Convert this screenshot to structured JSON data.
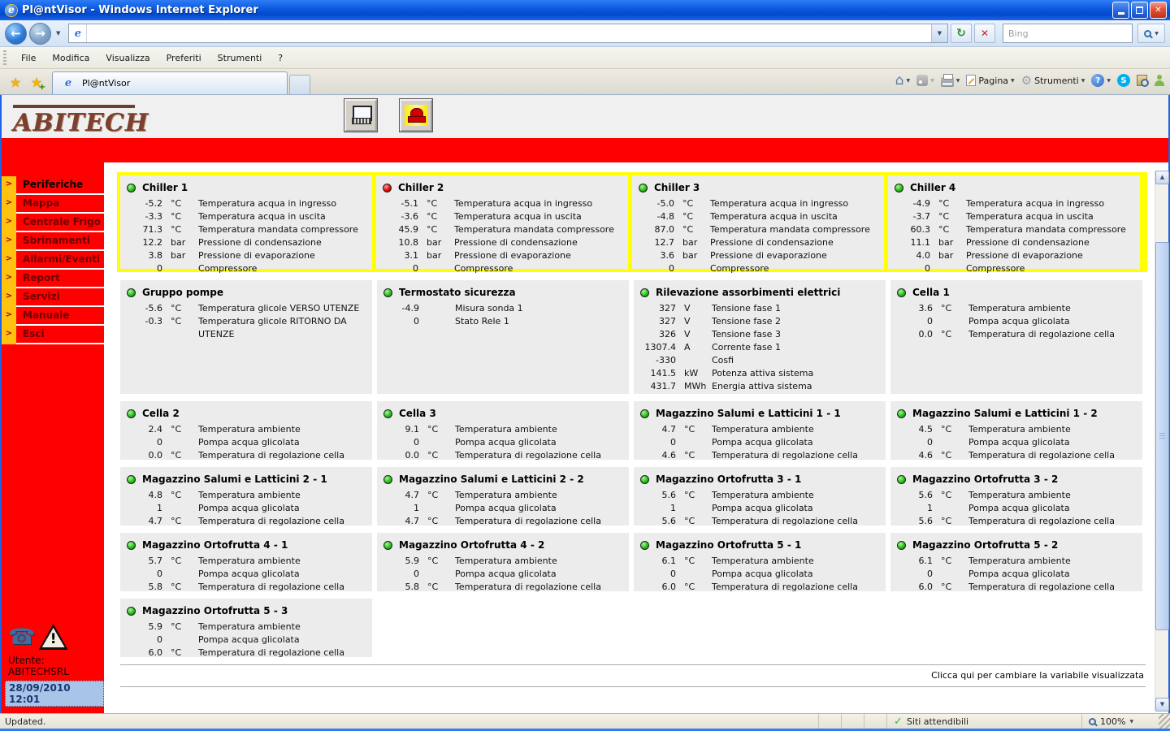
{
  "window": {
    "title": "Pl@ntVisor - Windows Internet Explorer"
  },
  "browser": {
    "menu_items": [
      "File",
      "Modifica",
      "Visualizza",
      "Preferiti",
      "Strumenti",
      "?"
    ],
    "tab_title": "Pl@ntVisor",
    "search_placeholder": "Bing",
    "toolbar": {
      "pagina_label": "Pagina",
      "strumenti_label": "Strumenti"
    }
  },
  "app": {
    "logo_text": "ABITECH",
    "sidebar": {
      "items": [
        {
          "label": "Periferiche",
          "active": true
        },
        {
          "label": "Mappa",
          "active": false
        },
        {
          "label": "Centrale Frigo",
          "active": false
        },
        {
          "label": "Sbrinamenti",
          "active": false
        },
        {
          "label": "Allarmi/Eventi",
          "active": false
        },
        {
          "label": "Report",
          "active": false
        },
        {
          "label": "Servizi",
          "active": false
        },
        {
          "label": "Manuale",
          "active": false
        },
        {
          "label": "Esci",
          "active": false
        }
      ],
      "user_label": "Utente:",
      "user_name": "ABITECHSRL",
      "datetime": "28/09/2010 12:01"
    },
    "footer_hint": "Clicca qui per cambiare la variabile visualizzata",
    "colors": {
      "led_green": "#22B714",
      "led_red": "#DE0000",
      "sidebar_red": "#FF0000",
      "highlight_yellow": "#FFFF00",
      "panel_gray": "#ECECEC"
    },
    "panel_rows": [
      {
        "highlight": true,
        "panels": [
          {
            "name": "Chiller 1",
            "led": "green",
            "rows": [
              [
                "-5.2",
                "°C",
                "Temperatura acqua in ingresso"
              ],
              [
                "-3.3",
                "°C",
                "Temperatura acqua in uscita"
              ],
              [
                "71.3",
                "°C",
                "Temperatura mandata compressore"
              ],
              [
                "12.2",
                "bar",
                "Pressione di condensazione"
              ],
              [
                "3.8",
                "bar",
                "Pressione di evaporazione"
              ],
              [
                "0",
                "",
                "Compressore"
              ]
            ]
          },
          {
            "name": "Chiller 2",
            "led": "red",
            "rows": [
              [
                "-5.1",
                "°C",
                "Temperatura acqua in ingresso"
              ],
              [
                "-3.6",
                "°C",
                "Temperatura acqua in uscita"
              ],
              [
                "45.9",
                "°C",
                "Temperatura mandata compressore"
              ],
              [
                "10.8",
                "bar",
                "Pressione di condensazione"
              ],
              [
                "3.1",
                "bar",
                "Pressione di evaporazione"
              ],
              [
                "0",
                "",
                "Compressore"
              ]
            ]
          },
          {
            "name": "Chiller 3",
            "led": "green",
            "rows": [
              [
                "-5.0",
                "°C",
                "Temperatura acqua in ingresso"
              ],
              [
                "-4.8",
                "°C",
                "Temperatura acqua in uscita"
              ],
              [
                "87.0",
                "°C",
                "Temperatura mandata compressore"
              ],
              [
                "12.7",
                "bar",
                "Pressione di condensazione"
              ],
              [
                "3.6",
                "bar",
                "Pressione di evaporazione"
              ],
              [
                "0",
                "",
                "Compressore"
              ]
            ]
          },
          {
            "name": "Chiller 4",
            "led": "green",
            "rows": [
              [
                "-4.9",
                "°C",
                "Temperatura acqua in ingresso"
              ],
              [
                "-3.7",
                "°C",
                "Temperatura acqua in uscita"
              ],
              [
                "60.3",
                "°C",
                "Temperatura mandata compressore"
              ],
              [
                "11.1",
                "bar",
                "Pressione di condensazione"
              ],
              [
                "4.0",
                "bar",
                "Pressione di evaporazione"
              ],
              [
                "0",
                "",
                "Compressore"
              ]
            ]
          }
        ]
      },
      {
        "highlight": false,
        "panels": [
          {
            "name": "Gruppo pompe",
            "led": "green",
            "rows": [
              [
                "-5.6",
                "°C",
                "Temperatura glicole VERSO UTENZE"
              ],
              [
                "-0.3",
                "°C",
                "Temperatura glicole RITORNO DA UTENZE"
              ]
            ]
          },
          {
            "name": "Termostato sicurezza",
            "led": "green",
            "rows": [
              [
                "-4.9",
                "",
                "Misura sonda 1"
              ],
              [
                "0",
                "",
                "Stato Rele 1"
              ]
            ]
          },
          {
            "name": "Rilevazione assorbimenti elettrici",
            "led": "green",
            "rows": [
              [
                "327",
                "V",
                "Tensione fase 1"
              ],
              [
                "327",
                "V",
                "Tensione fase 2"
              ],
              [
                "326",
                "V",
                "Tensione fase 3"
              ],
              [
                "1307.4",
                "A",
                "Corrente fase 1"
              ],
              [
                "-330",
                "",
                "Cosfi"
              ],
              [
                "141.5",
                "kW",
                "Potenza attiva sistema"
              ],
              [
                "431.7",
                "MWh",
                "Energia attiva sistema"
              ]
            ]
          },
          {
            "name": "Cella 1",
            "led": "green",
            "rows": [
              [
                "3.6",
                "°C",
                "Temperatura ambiente"
              ],
              [
                "0",
                "",
                "Pompa acqua glicolata"
              ],
              [
                "0.0",
                "°C",
                "Temperatura di regolazione cella"
              ]
            ]
          }
        ]
      },
      {
        "highlight": false,
        "panels": [
          {
            "name": "Cella 2",
            "led": "green",
            "rows": [
              [
                "2.4",
                "°C",
                "Temperatura ambiente"
              ],
              [
                "0",
                "",
                "Pompa acqua glicolata"
              ],
              [
                "0.0",
                "°C",
                "Temperatura di regolazione cella"
              ]
            ]
          },
          {
            "name": "Cella 3",
            "led": "green",
            "rows": [
              [
                "9.1",
                "°C",
                "Temperatura ambiente"
              ],
              [
                "0",
                "",
                "Pompa acqua glicolata"
              ],
              [
                "0.0",
                "°C",
                "Temperatura di regolazione cella"
              ]
            ]
          },
          {
            "name": "Magazzino Salumi e Latticini 1 - 1",
            "led": "green",
            "rows": [
              [
                "4.7",
                "°C",
                "Temperatura ambiente"
              ],
              [
                "0",
                "",
                "Pompa acqua glicolata"
              ],
              [
                "4.6",
                "°C",
                "Temperatura di regolazione cella"
              ]
            ]
          },
          {
            "name": "Magazzino Salumi e Latticini 1 - 2",
            "led": "green",
            "rows": [
              [
                "4.5",
                "°C",
                "Temperatura ambiente"
              ],
              [
                "0",
                "",
                "Pompa acqua glicolata"
              ],
              [
                "4.6",
                "°C",
                "Temperatura di regolazione cella"
              ]
            ]
          }
        ]
      },
      {
        "highlight": false,
        "panels": [
          {
            "name": "Magazzino Salumi e Latticini 2 - 1",
            "led": "green",
            "rows": [
              [
                "4.8",
                "°C",
                "Temperatura ambiente"
              ],
              [
                "1",
                "",
                "Pompa acqua glicolata"
              ],
              [
                "4.7",
                "°C",
                "Temperatura di regolazione cella"
              ]
            ]
          },
          {
            "name": "Magazzino Salumi e Latticini 2 - 2",
            "led": "green",
            "rows": [
              [
                "4.7",
                "°C",
                "Temperatura ambiente"
              ],
              [
                "1",
                "",
                "Pompa acqua glicolata"
              ],
              [
                "4.7",
                "°C",
                "Temperatura di regolazione cella"
              ]
            ]
          },
          {
            "name": "Magazzino Ortofrutta 3 - 1",
            "led": "green",
            "rows": [
              [
                "5.6",
                "°C",
                "Temperatura ambiente"
              ],
              [
                "1",
                "",
                "Pompa acqua glicolata"
              ],
              [
                "5.6",
                "°C",
                "Temperatura di regolazione cella"
              ]
            ]
          },
          {
            "name": "Magazzino Ortofrutta 3 - 2",
            "led": "green",
            "rows": [
              [
                "5.6",
                "°C",
                "Temperatura ambiente"
              ],
              [
                "1",
                "",
                "Pompa acqua glicolata"
              ],
              [
                "5.6",
                "°C",
                "Temperatura di regolazione cella"
              ]
            ]
          }
        ]
      },
      {
        "highlight": false,
        "panels": [
          {
            "name": "Magazzino Ortofrutta 4 - 1",
            "led": "green",
            "rows": [
              [
                "5.7",
                "°C",
                "Temperatura ambiente"
              ],
              [
                "0",
                "",
                "Pompa acqua glicolata"
              ],
              [
                "5.8",
                "°C",
                "Temperatura di regolazione cella"
              ]
            ]
          },
          {
            "name": "Magazzino Ortofrutta 4 - 2",
            "led": "green",
            "rows": [
              [
                "5.9",
                "°C",
                "Temperatura ambiente"
              ],
              [
                "0",
                "",
                "Pompa acqua glicolata"
              ],
              [
                "5.8",
                "°C",
                "Temperatura di regolazione cella"
              ]
            ]
          },
          {
            "name": "Magazzino Ortofrutta 5 - 1",
            "led": "green",
            "rows": [
              [
                "6.1",
                "°C",
                "Temperatura ambiente"
              ],
              [
                "0",
                "",
                "Pompa acqua glicolata"
              ],
              [
                "6.0",
                "°C",
                "Temperatura di regolazione cella"
              ]
            ]
          },
          {
            "name": "Magazzino Ortofrutta 5 - 2",
            "led": "green",
            "rows": [
              [
                "6.1",
                "°C",
                "Temperatura ambiente"
              ],
              [
                "0",
                "",
                "Pompa acqua glicolata"
              ],
              [
                "6.0",
                "°C",
                "Temperatura di regolazione cella"
              ]
            ]
          }
        ]
      },
      {
        "highlight": false,
        "panels": [
          {
            "name": "Magazzino Ortofrutta 5 - 3",
            "led": "green",
            "rows": [
              [
                "5.9",
                "°C",
                "Temperatura ambiente"
              ],
              [
                "0",
                "",
                "Pompa acqua glicolata"
              ],
              [
                "6.0",
                "°C",
                "Temperatura di regolazione cella"
              ]
            ]
          }
        ]
      }
    ]
  },
  "statusbar": {
    "left": "Updated.",
    "trusted_label": "Siti attendibili",
    "zoom_label": "100%"
  }
}
